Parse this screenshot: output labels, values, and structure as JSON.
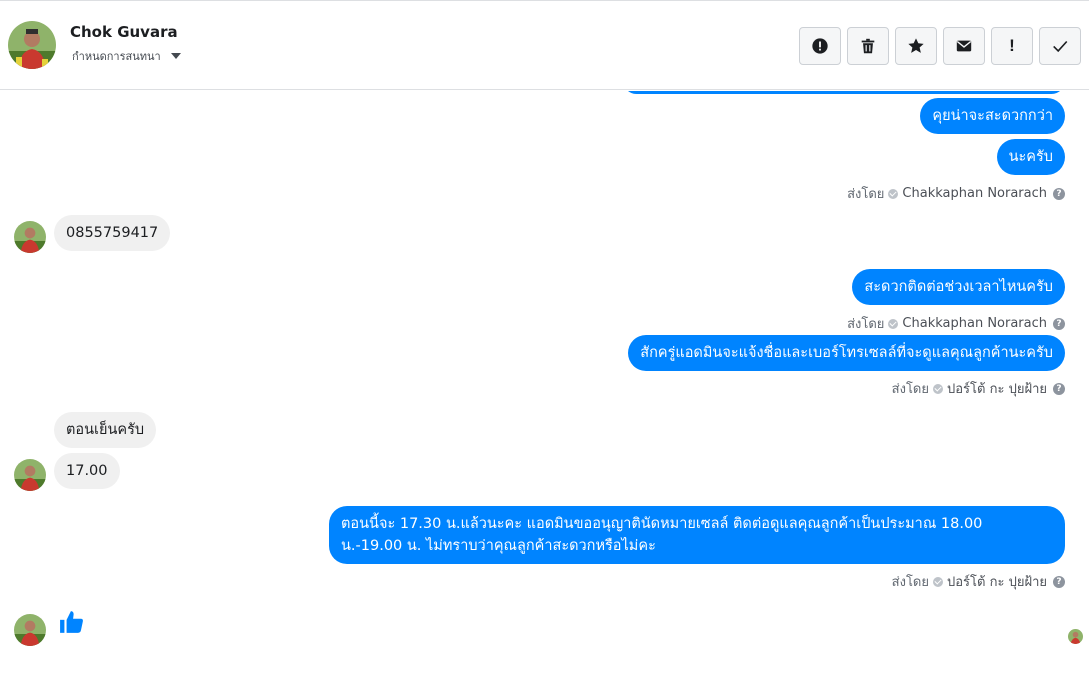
{
  "header": {
    "contact_name": "Chok Guvara",
    "assign_label": "กำหนดการสนทนา",
    "toolbar": [
      "spam-alert",
      "delete",
      "star",
      "mark-unread",
      "follow-up",
      "done"
    ]
  },
  "sent_by_prefix": "ส่งโดย",
  "messages": [
    {
      "dir": "out",
      "text": ""
    },
    {
      "dir": "out",
      "text": "คุยน่าจะสะดวกกว่า"
    },
    {
      "dir": "out",
      "text": "นะครับ"
    },
    {
      "type": "sent_by",
      "sender": "Chakkaphan Norarach"
    },
    {
      "dir": "in",
      "text": "0855759417"
    },
    {
      "dir": "out",
      "text": "สะดวกติดต่อช่วงเวลาไหนครับ"
    },
    {
      "type": "sent_by",
      "sender": "Chakkaphan Norarach"
    },
    {
      "dir": "out",
      "text": "สักครู่แอดมินจะแจ้งชื่อและเบอร์โทรเซลล์ที่จะดูแลคุณลูกค้านะครับ"
    },
    {
      "type": "sent_by",
      "sender": "ปอร์โต้ กะ ปุยฝ้าย"
    },
    {
      "dir": "in",
      "text": "ตอนเย็นครับ"
    },
    {
      "dir": "in",
      "text": "17.00"
    },
    {
      "dir": "out",
      "line1": "ตอนนี้จะ 17.30 น.แล้วนะคะ แอดมินขออนุญาตินัดหมายเซลล์ ติดต่อดูแลคุณลูกค้าเป็นประมาณ 18.00",
      "line2": "น.-19.00 น. ไม่ทราบว่าคุณลูกค้าสะดวกหรือไม่คะ"
    },
    {
      "type": "sent_by",
      "sender": "ปอร์โต้ กะ ปุยฝ้าย"
    },
    {
      "dir": "in",
      "type": "like"
    }
  ],
  "colors": {
    "outgoing": "#0084ff",
    "incoming": "#f0f0f0",
    "like": "#0084ff"
  }
}
